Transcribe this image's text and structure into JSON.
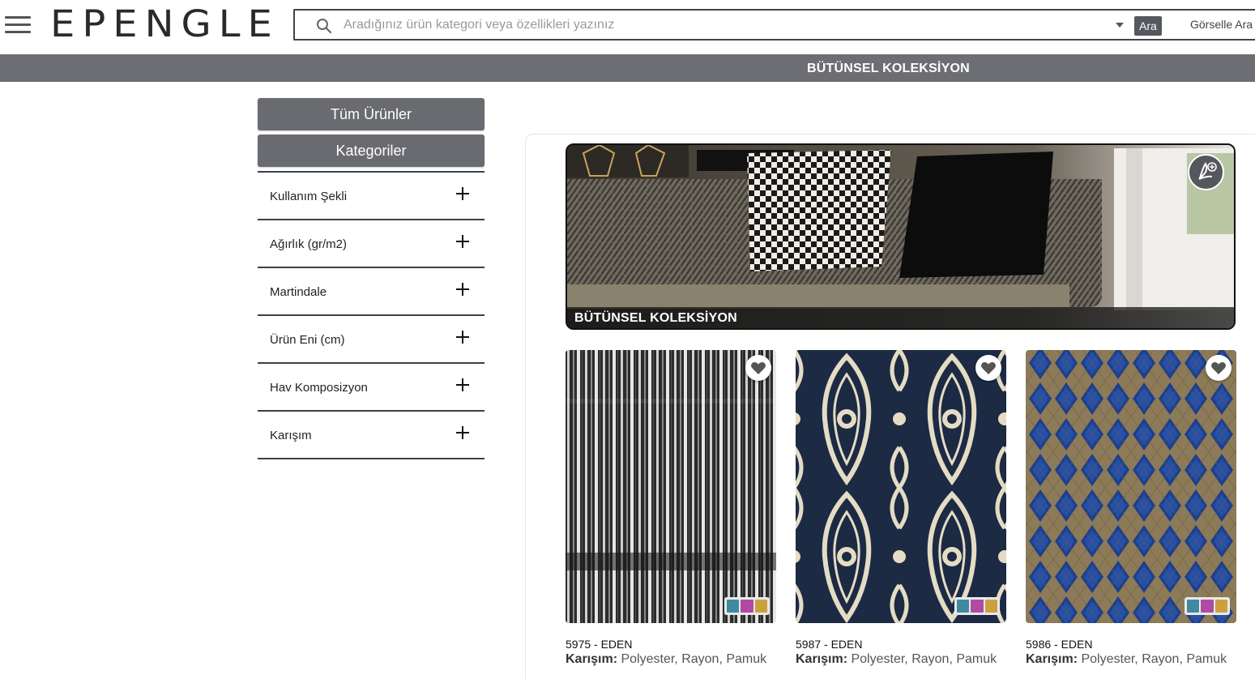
{
  "header": {
    "logo": "EPENGLE",
    "search_placeholder": "Aradığınız ürün kategori veya özellikleri yazınız",
    "search_button": "Ara",
    "image_search_button": "Görselle Ara"
  },
  "title_strip": "BÜTÜNSEL KOLEKSİYON",
  "sidebar": {
    "all_products": "Tüm Ürünler",
    "categories": "Kategoriler",
    "filters": [
      {
        "label": "Kullanım Şekli"
      },
      {
        "label": "Ağırlık (gr/m2)"
      },
      {
        "label": "Martindale"
      },
      {
        "label": "Ürün Eni (cm)"
      },
      {
        "label": "Hav Komposizyon"
      },
      {
        "label": "Karışım"
      }
    ]
  },
  "hero": {
    "caption": "BÜTÜNSEL KOLEKSİYON"
  },
  "products": [
    {
      "code": "5975 - EDEN",
      "mix_label": "Karışım:",
      "mix_value": "Polyester, Rayon, Pamuk"
    },
    {
      "code": "5987 - EDEN",
      "mix_label": "Karışım:",
      "mix_value": "Polyester, Rayon, Pamuk"
    },
    {
      "code": "5986 - EDEN",
      "mix_label": "Karışım:",
      "mix_value": "Polyester, Rayon, Pamuk"
    }
  ],
  "colors": {
    "strip": "#6d6e73",
    "button": "#6a6b70",
    "swatch_teal": "#3f8aa0",
    "swatch_magenta": "#b04aa5",
    "swatch_gold": "#c9a23e"
  }
}
